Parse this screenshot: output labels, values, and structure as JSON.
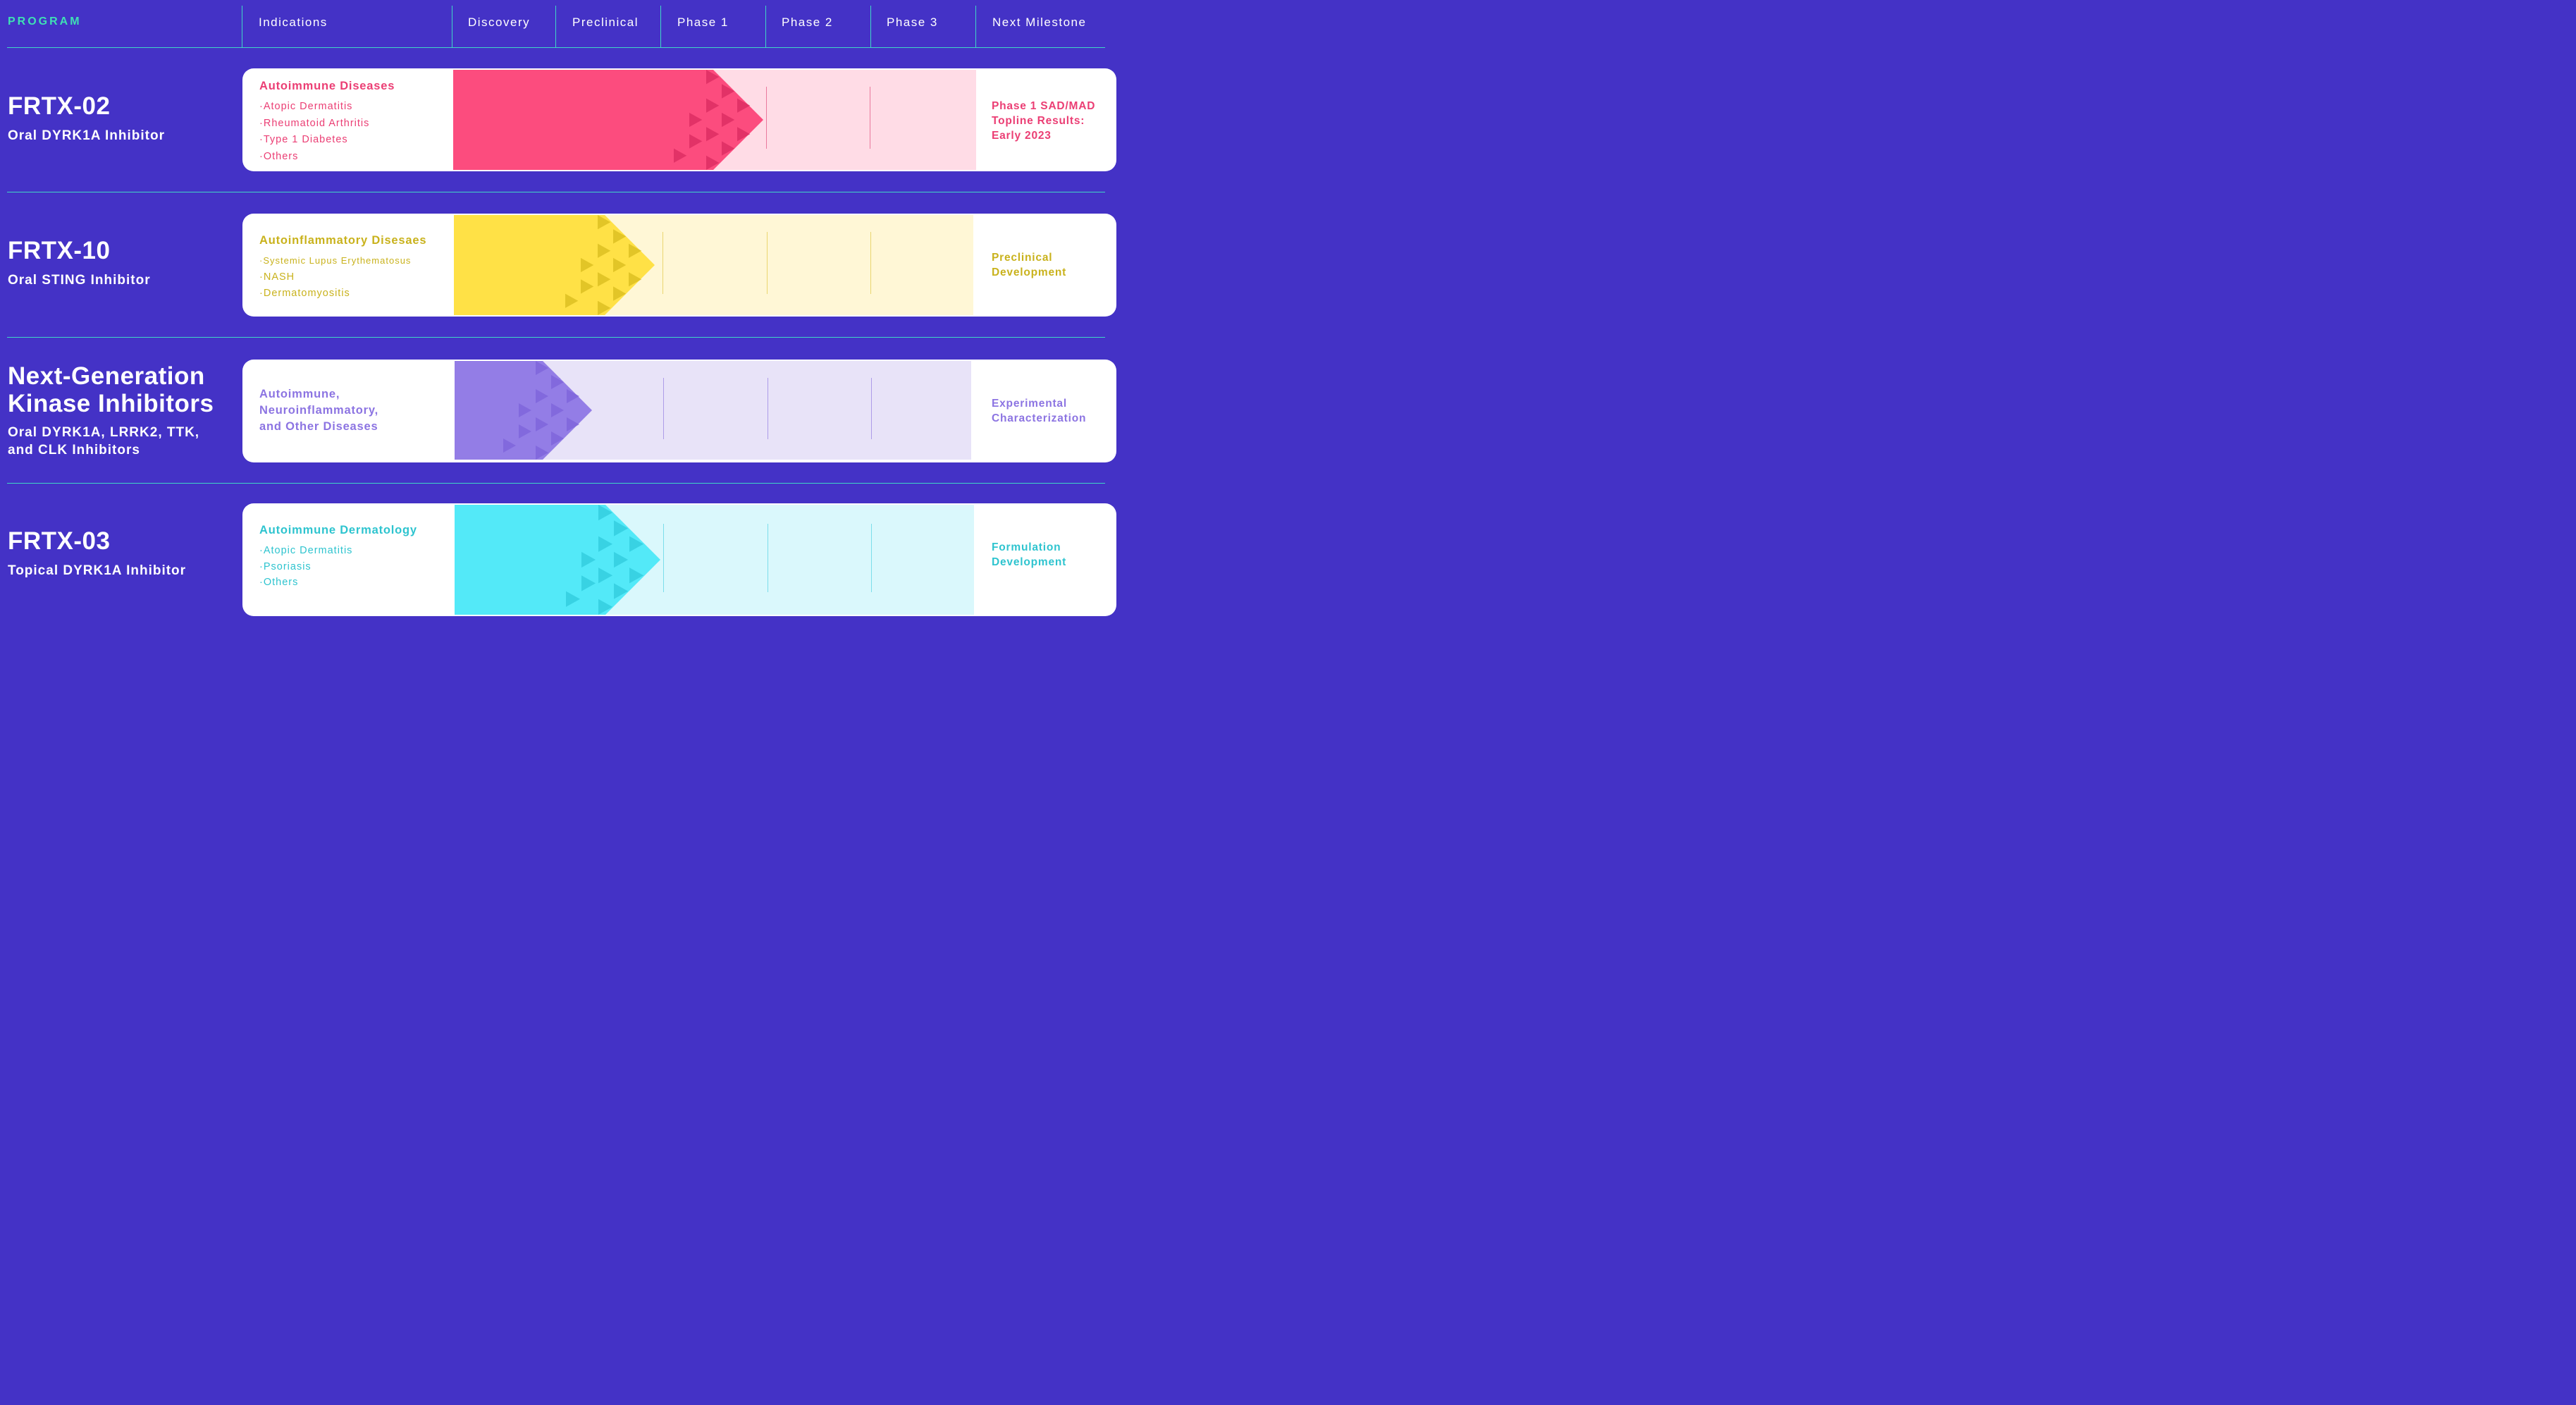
{
  "header": {
    "program": "PROGRAM",
    "columns": [
      "Indications",
      "Discovery",
      "Preclinical",
      "Phase 1",
      "Phase 2",
      "Phase 3",
      "Next Milestone"
    ]
  },
  "chart_data": {
    "type": "bar",
    "stages": [
      "Discovery",
      "Preclinical",
      "Phase 1",
      "Phase 2",
      "Phase 3"
    ],
    "programs": [
      {
        "name": "FRTX-02",
        "subtitle": "Oral DYRK1A Inhibitor",
        "indication_title": "Autoimmune Diseases",
        "indications": [
          "Atopic Dermatitis",
          "Rheumatoid Arthritis",
          "Type 1 Diabetes",
          "Others"
        ],
        "progress_stages": 2.5,
        "milestone": "Phase 1 SAD/MAD Topline Results: Early 2023",
        "color": "#FC4C7E",
        "light_color": "#FFDCE6",
        "dark_color": "#D92A60",
        "text_color": "#EB3E74"
      },
      {
        "name": "FRTX-10",
        "subtitle": "Oral STING Inhibitor",
        "indication_title": "Autoinflammatory Disesaes",
        "indications": [
          "Systemic Lupus Erythematosus",
          "NASH",
          "Dermatomyositis"
        ],
        "progress_stages": 1.45,
        "milestone": "Preclinical Development",
        "color": "#FFE146",
        "light_color": "#FFF7D6",
        "dark_color": "#D8BB1E",
        "text_color": "#C9B21C"
      },
      {
        "name": "Next-Generation Kinase Inhibitors",
        "subtitle": "Oral DYRK1A, LRRK2, TTK, and CLK Inhibitors",
        "indication_title": "Autoimmune, Neuroinflammatory, and Other Diseases",
        "indications": [],
        "progress_stages": 0.85,
        "milestone": "Experimental Characterization",
        "color": "#937DE6",
        "light_color": "#E8E3F8",
        "dark_color": "#7C63DA",
        "text_color": "#8C74E2"
      },
      {
        "name": "FRTX-03",
        "subtitle": "Topical DYRK1A Inhibitor",
        "indication_title": "Autoimmune Dermatology",
        "indications": [
          "Atopic Dermatitis",
          "Psoriasis",
          "Others"
        ],
        "progress_stages": 1.45,
        "milestone": "Formulation Development",
        "color": "#53E9F8",
        "light_color": "#DAF8FC",
        "dark_color": "#2FC9DC",
        "text_color": "#2EC4CF"
      }
    ]
  }
}
